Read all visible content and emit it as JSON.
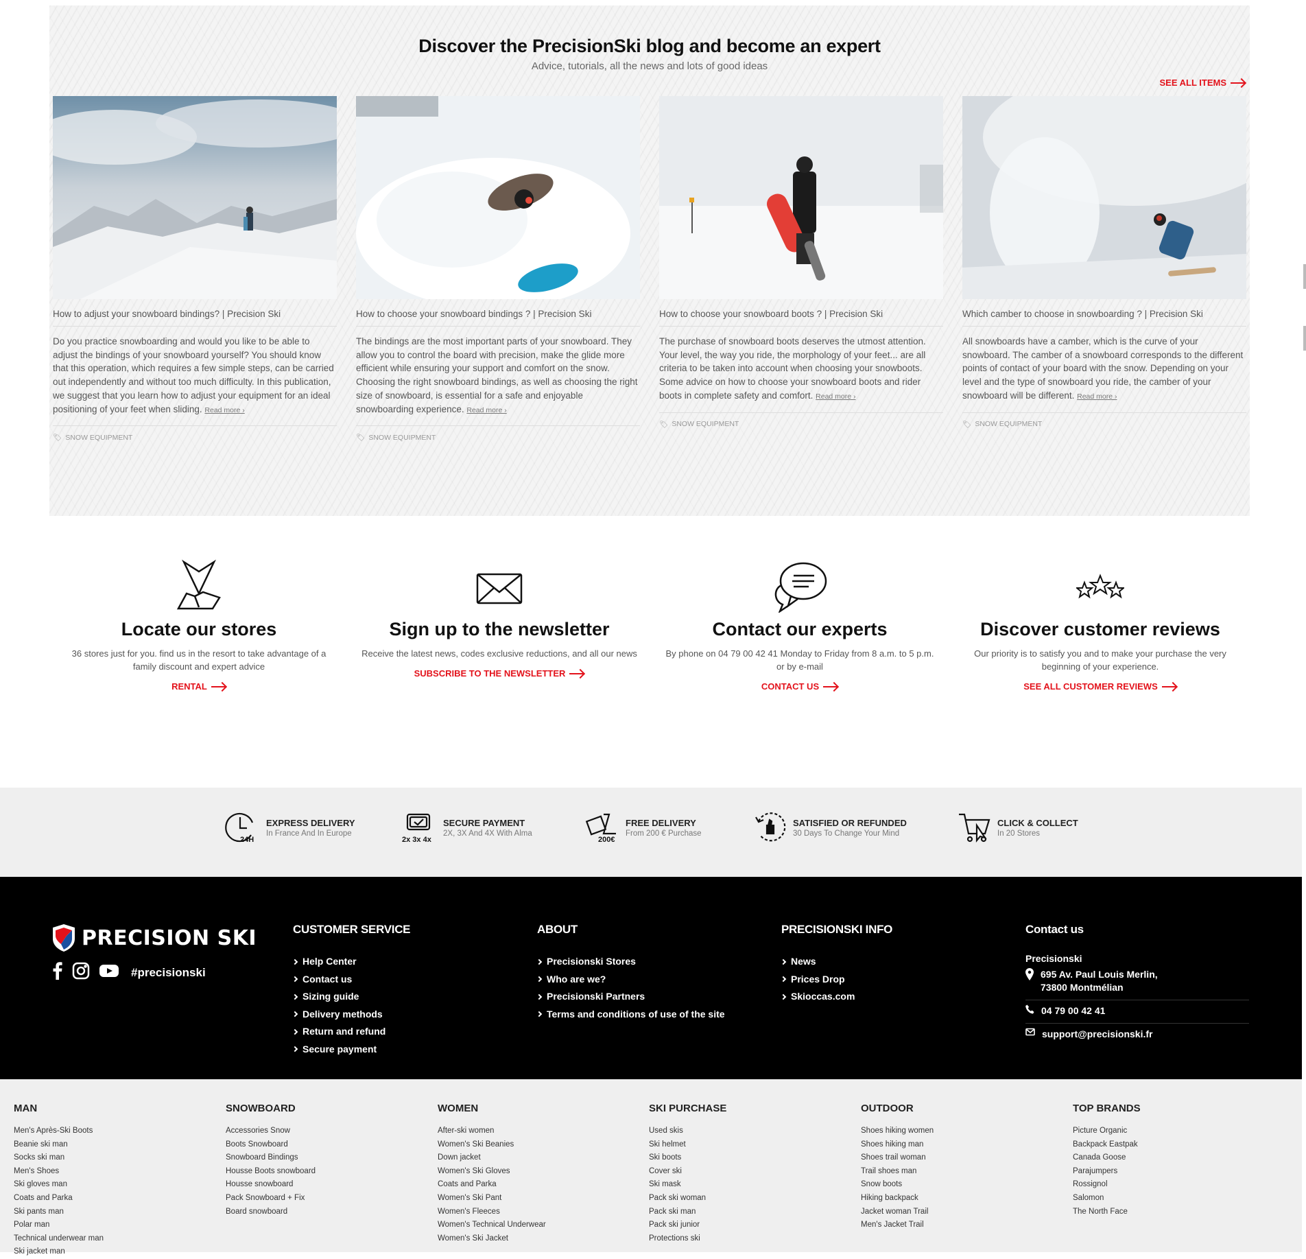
{
  "blog": {
    "title": "Discover the PrecisionSki blog and become an expert",
    "subtitle": "Advice, tutorials, all the news and lots of good ideas",
    "see_all": "SEE ALL ITEMS",
    "read_more": "Read more ›",
    "cards": [
      {
        "title": "How to adjust your snowboard bindings? | Precision Ski",
        "excerpt": "Do you practice snowboarding and would you like to be able to adjust the bindings of your snowboard yourself? You should know that this operation, which requires a few simple steps, can be carried out independently and without too much difficulty. In this publication, we suggest that you learn how to adjust your equipment for an ideal positioning of your feet when sliding.",
        "category": "SNOW EQUIPMENT"
      },
      {
        "title": "How to choose your snowboard bindings ? | Precision Ski",
        "excerpt": "The bindings are the most important parts of your snowboard. They allow you to control the board with precision, make the glide more efficient while ensuring your support and comfort on the snow. Choosing the right snowboard bindings, as well as choosing the right size of snowboard, is essential for a safe and enjoyable snowboarding experience.",
        "category": "SNOW EQUIPMENT"
      },
      {
        "title": "How to choose your snowboard boots ? | Precision Ski",
        "excerpt": "The purchase of snowboard boots deserves the utmost attention. Your level, the way you ride, the morphology of your feet... are all criteria to be taken into account when choosing your snowboots. Some advice on how to choose your snowboard boots and rider boots in complete safety and comfort.",
        "category": "SNOW EQUIPMENT"
      },
      {
        "title": "Which camber to choose in snowboarding ? | Precision Ski",
        "excerpt": "All snowboards have a camber, which is the curve of your snowboard. The camber of a snowboard corresponds to the different points of contact of your board with the snow. Depending on your level and the type of snowboard you ride, the camber of your snowboard will be different.",
        "category": "SNOW EQUIPMENT"
      }
    ]
  },
  "services": [
    {
      "title": "Locate our stores",
      "text": "36 stores just for you. find us in the resort to take advantage of a family discount and expert advice",
      "link": "RENTAL",
      "icon": "map-pin-icon"
    },
    {
      "title": "Sign up to the newsletter",
      "text": "Receive the latest news, codes exclusive reductions, and all our news",
      "link": "SUBSCRIBE TO THE NEWSLETTER",
      "icon": "envelope-icon"
    },
    {
      "title": "Contact our experts",
      "text": "By phone on 04 79 00 42 41 Monday to Friday from 8 a.m. to 5 p.m. or by e-mail",
      "link": "CONTACT US",
      "icon": "chat-bubbles-icon"
    },
    {
      "title": "Discover customer reviews",
      "text": "Our priority is to satisfy you and to make your purchase the very beginning of your experience.",
      "link": "SEE ALL CUSTOMER REVIEWS",
      "icon": "stars-icon"
    }
  ],
  "reassurance": [
    {
      "title": "EXPRESS DELIVERY",
      "subtitle": "In France And In Europe",
      "icon": "clock-24h-icon"
    },
    {
      "title": "SECURE PAYMENT",
      "subtitle": "2X, 3X And 4X With Alma",
      "icon": "card-payment-icon"
    },
    {
      "title": "FREE DELIVERY",
      "subtitle": "From 200 € Purchase",
      "icon": "box-delivery-icon"
    },
    {
      "title": "SATISFIED OR REFUNDED",
      "subtitle": "30 Days To Change Your Mind",
      "icon": "refund-icon"
    },
    {
      "title": "CLICK & COLLECT",
      "subtitle": "In 20 Stores",
      "icon": "cart-icon"
    }
  ],
  "reassurance_badges": {
    "express": "24H",
    "payment": "2x 3x 4x",
    "free": "200€"
  },
  "footer": {
    "brand": "PRECISION SKI",
    "hashtag": "#precisionski",
    "customer_service": {
      "title": "CUSTOMER SERVICE",
      "items": [
        "Help Center",
        "Contact us",
        "Sizing guide",
        "Delivery methods",
        "Return and refund",
        "Secure payment"
      ]
    },
    "about": {
      "title": "ABOUT",
      "items": [
        "Precisionski Stores",
        "Who are we?",
        "Precisionski Partners",
        "Terms and conditions of use of the site"
      ]
    },
    "info": {
      "title": "PRECISIONSKI INFO",
      "items": [
        "News",
        "Prices Drop",
        "Skioccas.com"
      ]
    },
    "contact": {
      "title": "Contact us",
      "name": "Precisionski",
      "address_line1": "695 Av. Paul Louis Merlin,",
      "address_line2": "73800 Montmélian",
      "phone": "04 79 00 42 41",
      "email": "support@precisionski.fr"
    }
  },
  "sitemap": [
    {
      "title": "MAN",
      "items": [
        "Men's Après-Ski Boots",
        "Beanie ski man",
        "Socks ski man",
        "Men's Shoes",
        "Ski gloves man",
        "Coats and Parka",
        "Ski pants man",
        "Polar man",
        "Technical underwear man",
        "Ski jacket man"
      ]
    },
    {
      "title": "SNOWBOARD",
      "items": [
        "Accessories Snow",
        "Boots Snowboard",
        "Snowboard Bindings",
        "Housse Boots snowboard",
        "Housse snowboard",
        "Pack Snowboard + Fix",
        "Board snowboard"
      ]
    },
    {
      "title": "WOMEN",
      "items": [
        "After-ski women",
        "Women's Ski Beanies",
        "Down jacket",
        "Women's Ski Gloves",
        "Coats and Parka",
        "Women's Ski Pant",
        "Women's Fleeces",
        "Women's Technical Underwear",
        "Women's Ski Jacket"
      ]
    },
    {
      "title": "SKI PURCHASE",
      "items": [
        "Used skis",
        "Ski helmet",
        "Ski boots",
        "Cover ski",
        "Ski mask",
        "Pack ski woman",
        "Pack ski man",
        "Pack ski junior",
        "Protections ski"
      ]
    },
    {
      "title": "OUTDOOR",
      "items": [
        "Shoes hiking women",
        "Shoes hiking man",
        "Shoes trail woman",
        "Trail shoes man",
        "Snow boots",
        "Hiking backpack",
        "Jacket woman Trail",
        "Men's Jacket Trail"
      ]
    },
    {
      "title": "TOP BRANDS",
      "items": [
        "Picture Organic",
        "Backpack Eastpak",
        "Canada Goose",
        "Parajumpers",
        "Rossignol",
        "Salomon",
        "The North Face"
      ]
    }
  ],
  "colors": {
    "accent": "#e3121b",
    "footer_bg": "#000000",
    "light_bg": "#efefef"
  }
}
